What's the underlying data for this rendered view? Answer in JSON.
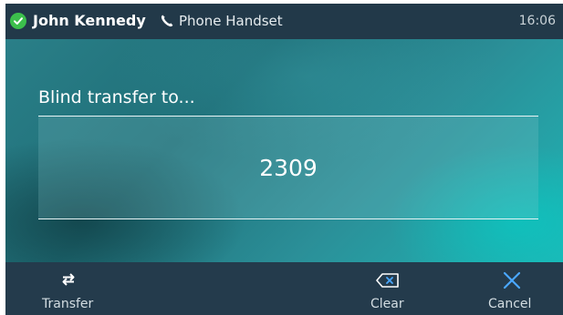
{
  "status_bar": {
    "caller_name": "John Kennedy",
    "audio_device": "Phone Handset",
    "time": "16:06",
    "status_icon": "check-circle-icon",
    "device_icon": "phone-icon"
  },
  "transfer": {
    "prompt": "Blind transfer to...",
    "number": "2309"
  },
  "softkeys": [
    {
      "label": "Transfer",
      "icon": "transfer-arrows-icon"
    },
    {
      "label": "Clear",
      "icon": "backspace-icon"
    },
    {
      "label": "Cancel",
      "icon": "close-icon"
    }
  ],
  "colors": {
    "status_bar_bg": "#223949",
    "softkey_bar_bg": "#243b4c",
    "accent_blue": "#4aa8ff",
    "status_green": "#3cbf4c"
  }
}
